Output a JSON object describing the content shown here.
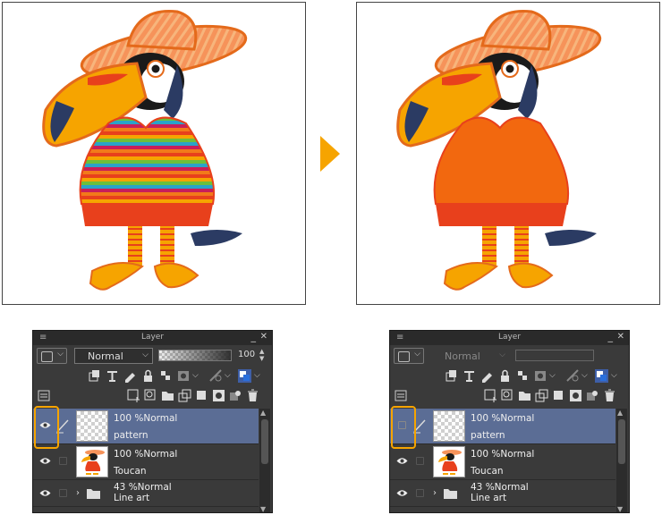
{
  "colors": {
    "accent_orange": "#f6a400",
    "selected_layer": "#5b6d95",
    "panel_bg": "#3a3a3a"
  },
  "arrow_icon": "right-triangle-icon",
  "panels": [
    {
      "id": "left",
      "title": "Layer",
      "blend_mode": "Normal",
      "opacity_value": "100",
      "layers": [
        {
          "opacity": "100 %Normal",
          "name": "pattern",
          "visible": true,
          "selected": true
        },
        {
          "opacity": "100 %Normal",
          "name": "Toucan",
          "visible": true,
          "selected": false
        },
        {
          "opacity": "43 %Normal",
          "name": "Line art",
          "visible": true,
          "selected": false,
          "folder": true
        }
      ]
    },
    {
      "id": "right",
      "title": "Layer",
      "blend_mode": "Normal",
      "opacity_value": "",
      "layers": [
        {
          "opacity": "100 %Normal",
          "name": "pattern",
          "visible": false,
          "selected": true
        },
        {
          "opacity": "100 %Normal",
          "name": "Toucan",
          "visible": true,
          "selected": false
        },
        {
          "opacity": "43 %Normal",
          "name": "Line art",
          "visible": true,
          "selected": false,
          "folder": true
        }
      ]
    }
  ]
}
